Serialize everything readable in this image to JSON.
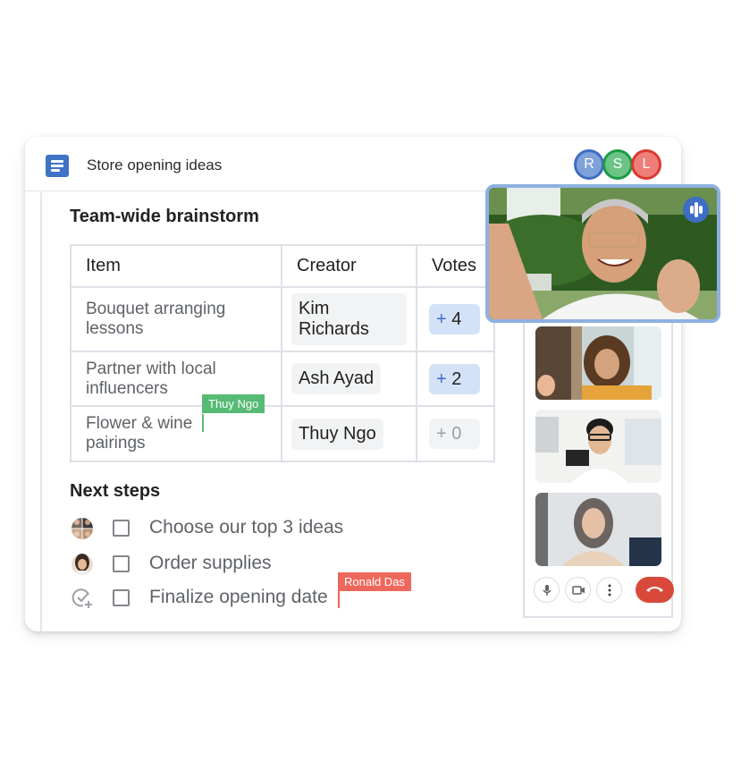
{
  "document": {
    "title": "Store opening ideas",
    "icon": "google-docs-icon"
  },
  "collaborators": [
    {
      "initial": "R",
      "color": "#3e6dc4"
    },
    {
      "initial": "S",
      "color": "#1d9a46"
    },
    {
      "initial": "L",
      "color": "#d93a30"
    }
  ],
  "brainstorm": {
    "heading": "Team-wide brainstorm",
    "columns": [
      "Item",
      "Creator",
      "Votes"
    ],
    "rows": [
      {
        "item_line1": "Bouquet arranging",
        "item_line2": "lessons",
        "creator": "Kim Richards",
        "votes": "4",
        "voted": true
      },
      {
        "item_line1": "Partner with local",
        "item_line2": "influencers",
        "creator": "Ash Ayad",
        "votes": "2",
        "voted": true
      },
      {
        "item_line1": "Flower & wine",
        "item_line2": "pairings",
        "creator": "Thuy Ngo",
        "votes": "0",
        "voted": false
      }
    ],
    "vote_prefix": "+"
  },
  "cursors": [
    {
      "name": "Thuy Ngo",
      "color": "#57bb75"
    },
    {
      "name": "Ronald Das",
      "color": "#ee675c"
    }
  ],
  "next_steps": {
    "heading": "Next steps",
    "items": [
      {
        "label": "Choose our top 3 ideas",
        "assignee": "group-avatar",
        "checked": false
      },
      {
        "label": "Order supplies",
        "assignee": "person-avatar",
        "checked": false
      },
      {
        "label": "Finalize opening date",
        "assignee": "add-assignee-icon",
        "checked": false
      }
    ]
  },
  "meet": {
    "main_speaker": "speaking-indicator",
    "tiles": [
      "participant-1",
      "participant-2",
      "participant-3"
    ],
    "controls": [
      "microphone-icon",
      "camera-icon",
      "more-options-icon",
      "hang-up-icon"
    ],
    "hangup_color": "#d9493b"
  }
}
